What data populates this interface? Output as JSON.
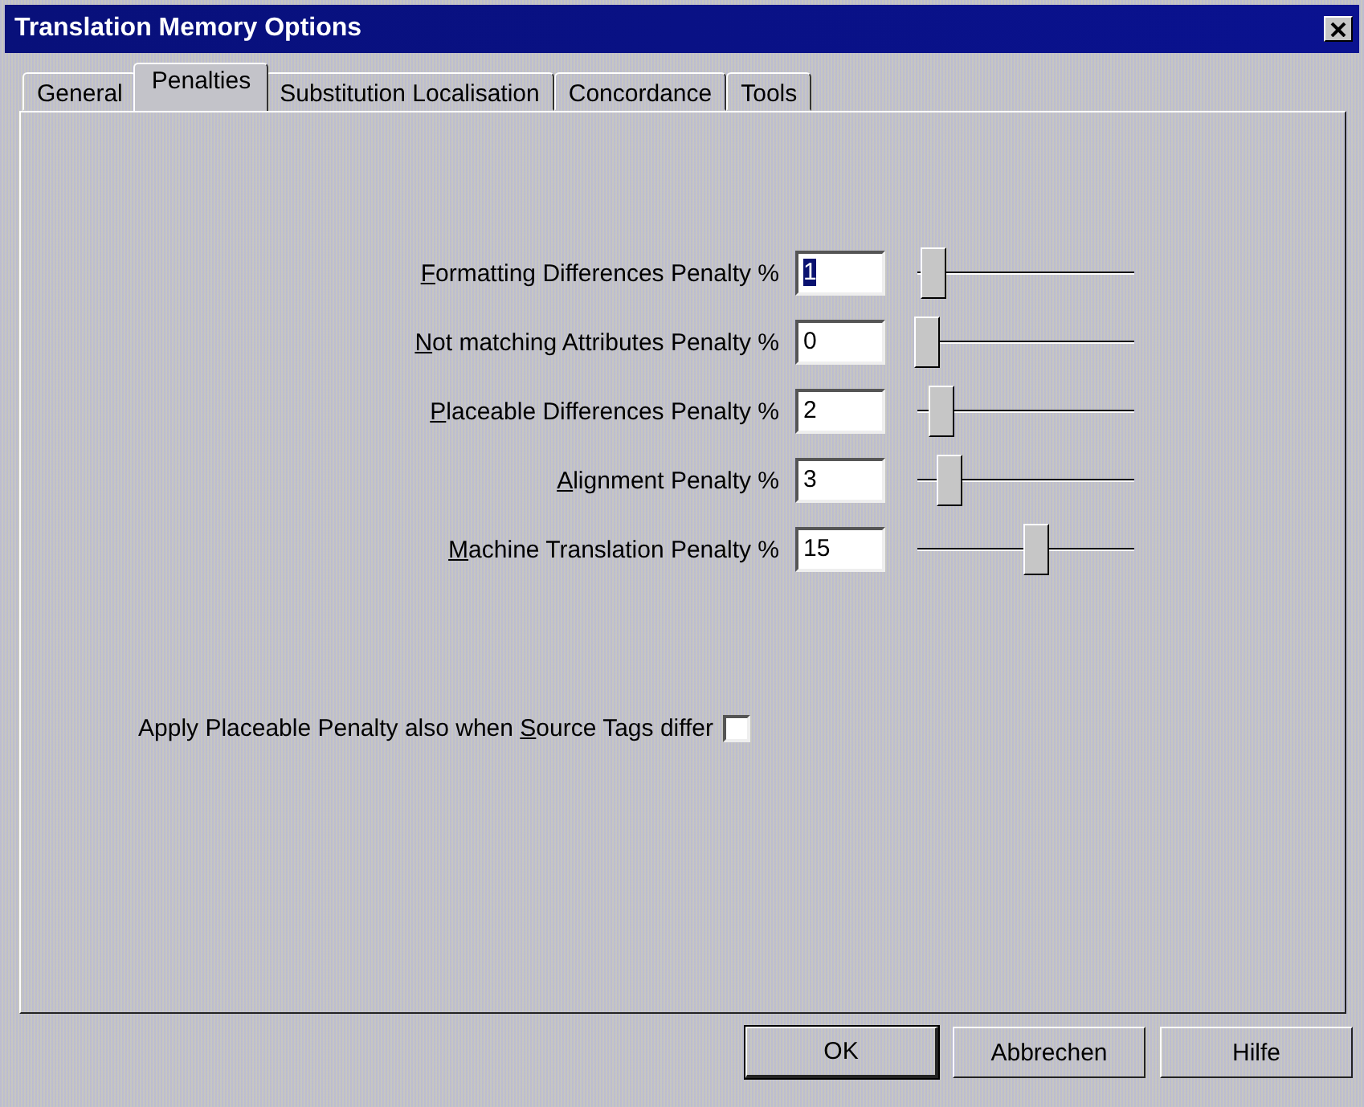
{
  "window": {
    "title": "Translation Memory Options"
  },
  "tabs": [
    {
      "label": "General",
      "selected": false
    },
    {
      "label": "Penalties",
      "selected": true
    },
    {
      "label": "Substitution Localisation",
      "selected": false
    },
    {
      "label": "Concordance",
      "selected": false
    },
    {
      "label": "Tools",
      "selected": false
    }
  ],
  "penalties": [
    {
      "access_key": "F",
      "label_after": "ormatting Differences Penalty %",
      "value": "1",
      "text_selected": true,
      "level": 0.033
    },
    {
      "access_key": "N",
      "label_after": "ot matching Attributes Penalty %",
      "value": "0",
      "text_selected": false,
      "level": 0
    },
    {
      "access_key": "P",
      "label_after": "laceable Differences Penalty %",
      "value": "2",
      "text_selected": false,
      "level": 0.067
    },
    {
      "access_key": "A",
      "label_after": "lignment Penalty %",
      "value": "3",
      "text_selected": false,
      "level": 0.1
    },
    {
      "access_key": "M",
      "label_after": "achine Translation Penalty %",
      "value": "15",
      "text_selected": false,
      "level": 0.5
    }
  ],
  "option": {
    "label_before": "Apply Placeable Penalty also when ",
    "access_key": "S",
    "label_after": "ource Tags differ",
    "checked": false
  },
  "buttons": [
    {
      "label": "OK",
      "default": true
    },
    {
      "label": "Abbrechen",
      "default": false
    },
    {
      "label": "Hilfe",
      "default": false
    }
  ]
}
